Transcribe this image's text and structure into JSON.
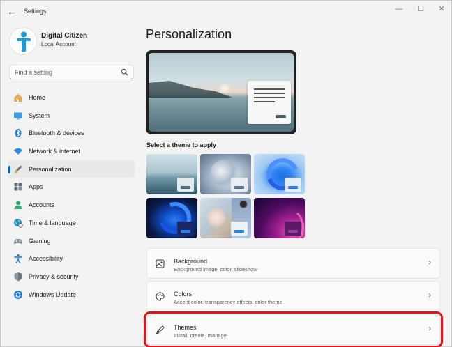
{
  "titlebar": {
    "title": "Settings",
    "back_glyph": "←",
    "minimize_glyph": "—",
    "maximize_glyph": "☐",
    "close_glyph": "✕"
  },
  "profile": {
    "name": "Digital Citizen",
    "account_type": "Local Account"
  },
  "search": {
    "placeholder": "Find a setting"
  },
  "nav": {
    "items": [
      {
        "label": "Home",
        "icon": "home-icon"
      },
      {
        "label": "System",
        "icon": "display-icon"
      },
      {
        "label": "Bluetooth & devices",
        "icon": "bluetooth-icon"
      },
      {
        "label": "Network & internet",
        "icon": "wifi-icon"
      },
      {
        "label": "Personalization",
        "icon": "brush-icon",
        "selected": true
      },
      {
        "label": "Apps",
        "icon": "apps-icon"
      },
      {
        "label": "Accounts",
        "icon": "person-icon"
      },
      {
        "label": "Time & language",
        "icon": "globe-clock-icon"
      },
      {
        "label": "Gaming",
        "icon": "gamepad-icon"
      },
      {
        "label": "Accessibility",
        "icon": "accessibility-icon"
      },
      {
        "label": "Privacy & security",
        "icon": "shield-icon"
      },
      {
        "label": "Windows Update",
        "icon": "update-icon"
      }
    ]
  },
  "main": {
    "title": "Personalization",
    "themes_label": "Select a theme to apply",
    "themes": [
      {
        "name": "theme-1"
      },
      {
        "name": "theme-2"
      },
      {
        "name": "theme-3"
      },
      {
        "name": "theme-4"
      },
      {
        "name": "theme-5"
      },
      {
        "name": "theme-6"
      }
    ],
    "cards": {
      "background": {
        "title": "Background",
        "subtitle": "Background image, color, slideshow",
        "icon": "image-icon"
      },
      "colors": {
        "title": "Colors",
        "subtitle": "Accent color, transparency effects, color theme",
        "icon": "palette-icon"
      },
      "themes": {
        "title": "Themes",
        "subtitle": "Install, create, manage",
        "icon": "brush-icon",
        "highlighted": true
      }
    }
  },
  "colors": {
    "accent": "#005fb8",
    "highlight_outline": "#e3121b",
    "window_bg": "#f3f3f3"
  }
}
